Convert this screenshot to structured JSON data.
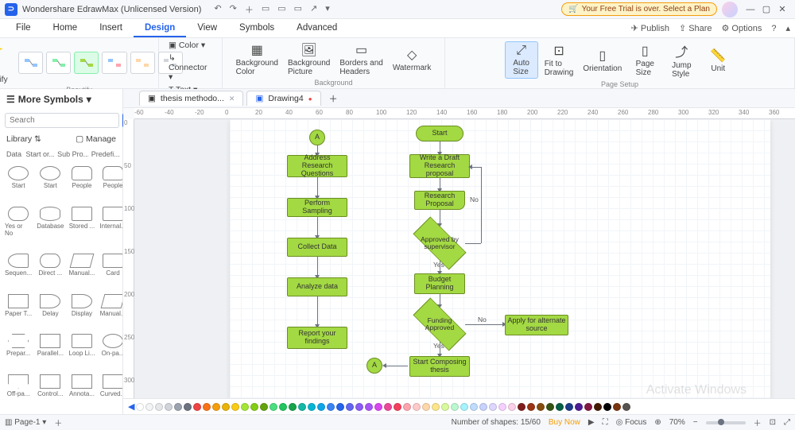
{
  "titlebar": {
    "app_name": "Wondershare EdrawMax (Unlicensed Version)",
    "trial_message": "Your Free Trial is over. Select a Plan"
  },
  "menubar": {
    "tabs": [
      "File",
      "Home",
      "Insert",
      "Design",
      "View",
      "Symbols",
      "Advanced"
    ],
    "active_index": 3,
    "right": {
      "publish": "Publish",
      "share": "Share",
      "options": "Options"
    }
  },
  "ribbon": {
    "beautify_btn": "One Click\nBeautify",
    "group_beautify": "Beautify",
    "text_items": {
      "color": "Color",
      "connector": "Connector",
      "text": "Text"
    },
    "bg_color": "Background\nColor",
    "bg_picture": "Background\nPicture",
    "borders": "Borders and\nHeaders",
    "watermark": "Watermark",
    "group_background": "Background",
    "auto_size": "Auto\nSize",
    "fit_drawing": "Fit to\nDrawing",
    "orientation": "Orientation",
    "page_size": "Page\nSize",
    "jump_style": "Jump\nStyle",
    "unit": "Unit",
    "group_page": "Page Setup"
  },
  "sidebar": {
    "header": "More Symbols",
    "search_placeholder": "Search",
    "search_btn": "Search",
    "library_label": "Library",
    "manage_label": "Manage",
    "filter_tabs": [
      "Data",
      "Start or...",
      "Sub Pro...",
      "Predefi..."
    ],
    "shapes": [
      "Start",
      "Start",
      "People",
      "People",
      "Yes or No",
      "Database",
      "Stored ...",
      "Internal...",
      "Sequen...",
      "Direct ...",
      "Manual...",
      "Card",
      "Paper T...",
      "Delay",
      "Display",
      "Manual...",
      "Prepar...",
      "Parallel...",
      "Loop Li...",
      "On-pa...",
      "Off-pa...",
      "Control...",
      "Annota...",
      "Curved..."
    ]
  },
  "doctabs": [
    {
      "title": "thesis methodo...",
      "unsaved": false
    },
    {
      "title": "Drawing4",
      "unsaved": true
    }
  ],
  "ruler_h": [
    "-60",
    "-40",
    "-20",
    "0",
    "20",
    "40",
    "60",
    "80",
    "100",
    "120",
    "140",
    "160",
    "180",
    "200",
    "220",
    "240",
    "260",
    "280",
    "300",
    "320",
    "340",
    "360"
  ],
  "ruler_v": [
    "0",
    "50",
    "100",
    "150",
    "200",
    "250",
    "300"
  ],
  "flowchart": {
    "left_col": {
      "connA": "A",
      "n1": "Address Research Questions",
      "n2": "Perform Sampling",
      "n3": "Collect Data",
      "n4": "Analyze data",
      "n5": "Report your findings",
      "connB": "A"
    },
    "right_col": {
      "start": "Start",
      "n1": "Write a Draft Research proposal",
      "n2": "Research Proposal",
      "d1": "Approved by supervisor",
      "n3": "Budget Planning",
      "d2": "Funding Approved",
      "alt": "Apply for alternate source",
      "n4": "Start Composing thesis"
    },
    "labels": {
      "yes": "Yes",
      "no": "No"
    }
  },
  "statusbar": {
    "page_label": "Page-1",
    "shape_count": "Number of shapes: 15/60",
    "buy_now": "Buy Now",
    "focus": "Focus",
    "zoom": "70%"
  },
  "watermark": "Activate Windows",
  "palette": [
    "#ffffff",
    "#f3f4f6",
    "#e5e7eb",
    "#d1d5db",
    "#9ca3af",
    "#6b7280",
    "#ef4444",
    "#f97316",
    "#f59e0b",
    "#eab308",
    "#facc15",
    "#a3e635",
    "#84cc16",
    "#65a30d",
    "#4ade80",
    "#22c55e",
    "#16a34a",
    "#14b8a6",
    "#06b6d4",
    "#0ea5e9",
    "#3b82f6",
    "#2563eb",
    "#6366f1",
    "#8b5cf6",
    "#a855f7",
    "#d946ef",
    "#ec4899",
    "#f43f5e",
    "#fda4af",
    "#fecaca",
    "#fed7aa",
    "#fde68a",
    "#d9f99d",
    "#bbf7d0",
    "#a5f3fc",
    "#bfdbfe",
    "#c7d2fe",
    "#ddd6fe",
    "#f5d0fe",
    "#fbcfe8",
    "#7f1d1d",
    "#9a3412",
    "#854d0e",
    "#365314",
    "#065f46",
    "#1e3a8a",
    "#4c1d95",
    "#831843",
    "#451a03",
    "#000000",
    "#78350f",
    "#57534e"
  ]
}
